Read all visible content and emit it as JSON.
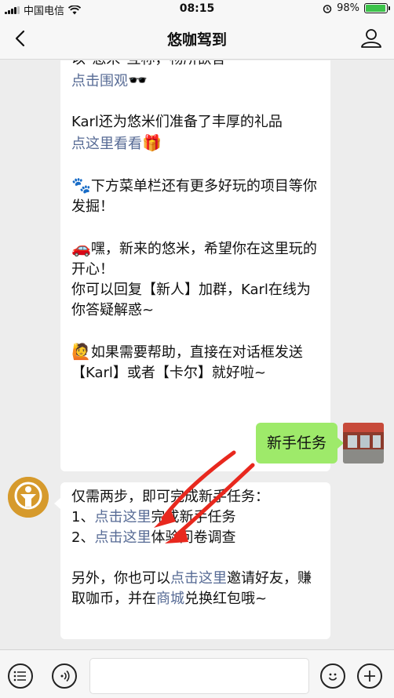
{
  "status_bar": {
    "carrier": "中国电信",
    "time": "08:15",
    "battery_text": "98%",
    "battery_level": 0.98,
    "battery_color": "#3cc34a"
  },
  "nav": {
    "title": "悠咖驾到",
    "back_icon": "back-chevron-icon",
    "user_icon": "user-profile-icon"
  },
  "messages": {
    "received_top": {
      "p1": {
        "line1": "以\"悠米\"互称，畅所欲言",
        "link": "点击围观",
        "emoji": "🕶️"
      },
      "p2": {
        "line1": "Karl还为悠米们准备了丰厚的礼品",
        "link": "点这里看看",
        "emoji": "🎁"
      },
      "p3": {
        "emoji": "🐾",
        "text": "下方菜单栏还有更多好玩的项目等你发掘！"
      },
      "p4": {
        "emoji": "🚗",
        "text1": "嘿，新来的悠米，希望你在这里玩的开心！",
        "text2": "你可以回复【新人】加群，Karl在线为你答疑解惑~"
      },
      "p5": {
        "emoji": "🙋",
        "text": "如果需要帮助，直接在对话框发送【Karl】或者【卡尔】就好啦~"
      }
    },
    "sent": {
      "text": "新手任务"
    },
    "received_bottom": {
      "intro": "仅需两步，即可完成新手任务：",
      "step1": {
        "prefix": "1、",
        "link": "点击这里",
        "suffix": "完成新手任务"
      },
      "step2": {
        "prefix": "2、",
        "link": "点击这里",
        "suffix": "体验问卷调查"
      },
      "extra": {
        "t1": "另外，你也可以",
        "link1": "点击这里",
        "t2": "邀请好友，赚取咖币，并在",
        "link2": "商城",
        "t3": "兑换红包哦~"
      }
    }
  },
  "input_bar": {
    "menu_icon": "menu-list-icon",
    "voice_icon": "voice-icon",
    "emoji_icon": "emoji-face-icon",
    "plus_icon": "plus-icon"
  },
  "colors": {
    "link": "#576b95",
    "sent_bubble": "#9eea6a",
    "arrow": "#e8281e",
    "avatar": "#d69a2c"
  }
}
